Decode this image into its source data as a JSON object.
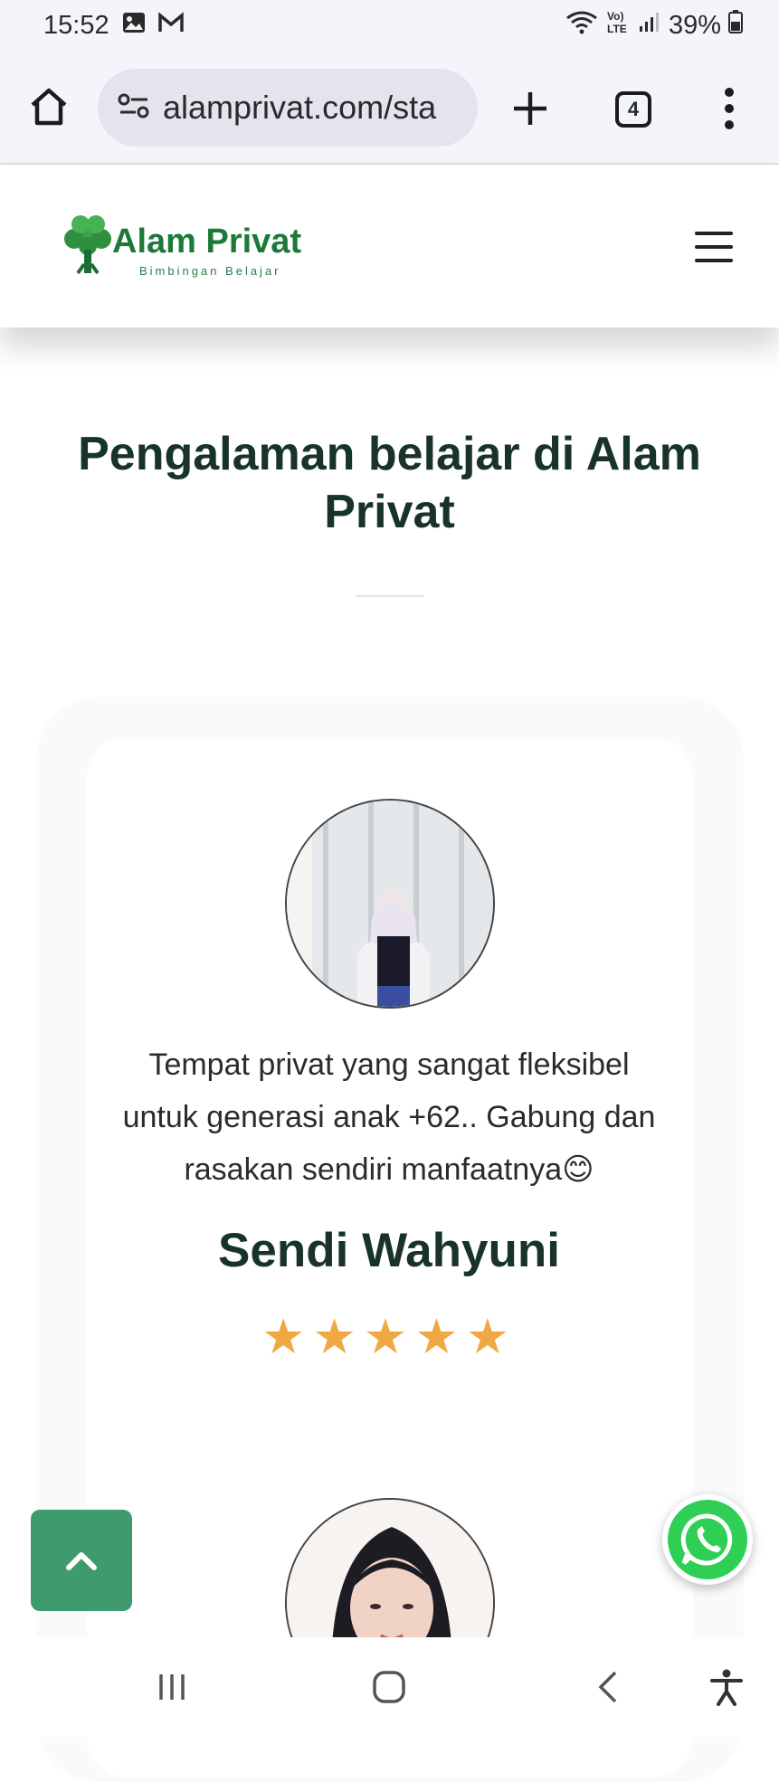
{
  "status_bar": {
    "time": "15:52",
    "notification_icons": [
      "gallery-icon",
      "gmail-icon"
    ],
    "system_icons": [
      "wifi-icon",
      "volte-icon",
      "signal-icon"
    ],
    "battery_percent": "39%"
  },
  "browser": {
    "url": "alamprivat.com/sta",
    "tab_count": "4"
  },
  "site": {
    "brand_name": "Alam Privat",
    "tagline": "Bimbingan Belajar",
    "brand_color": "#1b7a3a"
  },
  "section": {
    "title": "Pengalaman belajar di Alam Privat"
  },
  "testimonials": [
    {
      "text": "Tempat privat yang sangat fleksibel untuk generasi anak +62.. Gabung dan rasakan sendiri manfaatnya😊",
      "name": "Sendi Wahyuni",
      "rating": 5,
      "stars": "★★★★★"
    }
  ],
  "floating": {
    "back_to_top_color": "#3f9a6e",
    "whatsapp_color": "#2ecf54"
  },
  "nav_bar": {
    "items": [
      "recent-apps-icon",
      "home-icon",
      "back-icon",
      "accessibility-icon"
    ]
  }
}
